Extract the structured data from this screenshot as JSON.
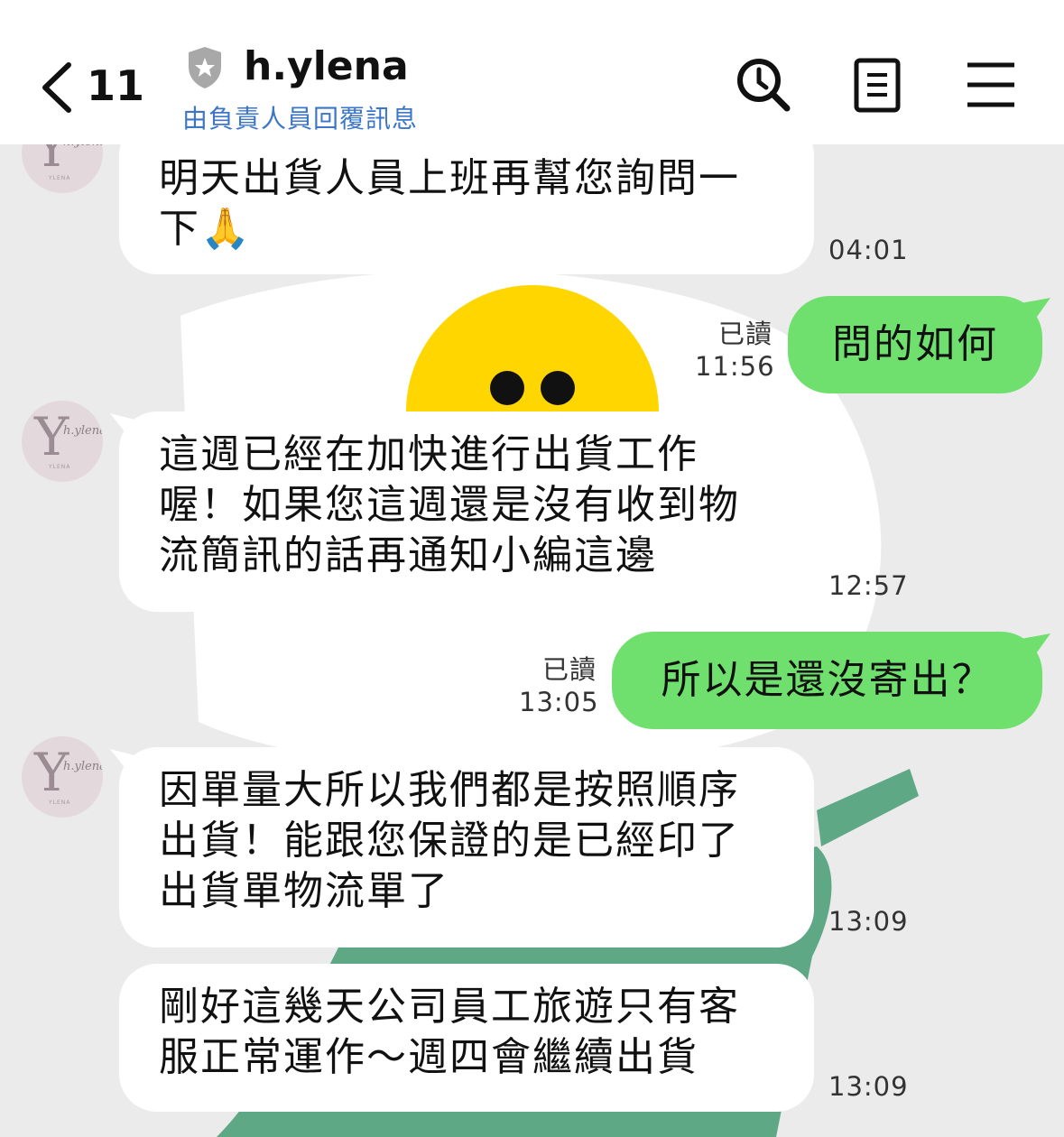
{
  "header": {
    "back_count": "11",
    "contact_name": "h.ylena",
    "subtitle": "由負責人員回覆訊息"
  },
  "avatar": {
    "letter": "Y",
    "script": "h.ylena",
    "tagline": "YLENA"
  },
  "messages": [
    {
      "side": "in",
      "text_line1": "明天出貨人員上班再幫您詢問一",
      "text_line2": "下🙏",
      "time": "04:01"
    },
    {
      "side": "out",
      "text": "問的如何",
      "read": "已讀",
      "time": "11:56"
    },
    {
      "side": "in",
      "text_line1": "這週已經在加快進行出貨工作",
      "text_line2": "喔！如果您這週還是沒有收到物",
      "text_line3": "流簡訊的話再通知小編這邊",
      "time": "12:57"
    },
    {
      "side": "out",
      "text": "所以是還沒寄出？",
      "read": "已讀",
      "time": "13:05"
    },
    {
      "side": "in",
      "text_line1": "因單量大所以我們都是按照順序",
      "text_line2": "出貨！能跟您保證的是已經印了",
      "text_line3": "出貨單物流單了",
      "time": "13:09"
    },
    {
      "side": "in",
      "text_line1": "剛好這幾天公司員工旅遊只有客",
      "text_line2": "服正常運作～週四會繼續出貨",
      "time": "13:09"
    }
  ],
  "colors": {
    "outgoing_bubble": "#6fe06d",
    "incoming_bubble": "#ffffff",
    "chat_background": "#ebebeb",
    "subtitle_link": "#3c76c8"
  },
  "icons": [
    "back-chevron-icon",
    "shield-star-icon",
    "search-icon",
    "notes-icon",
    "menu-icon"
  ]
}
